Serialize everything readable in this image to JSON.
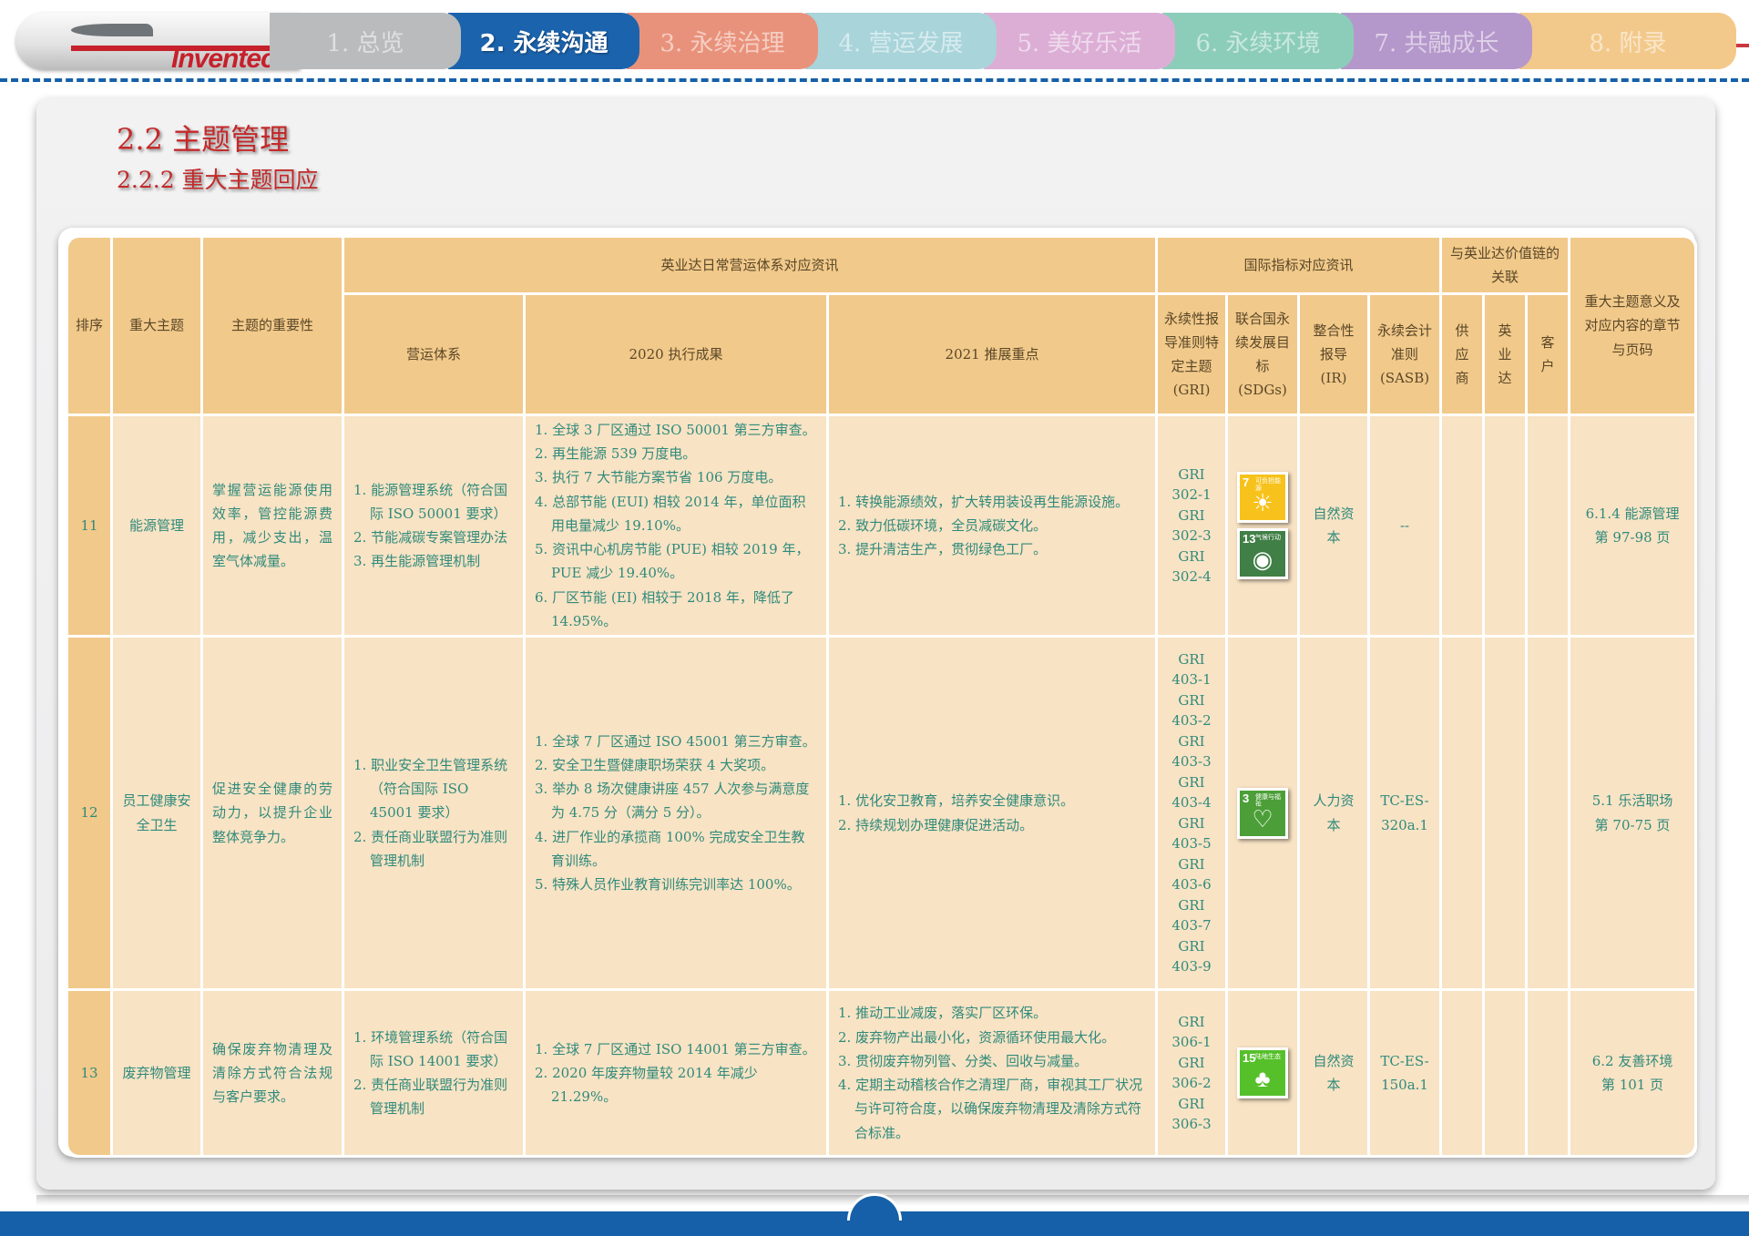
{
  "brand": {
    "logo_text": "Inventec"
  },
  "nav": {
    "tabs": [
      {
        "label": "1. 总览",
        "color": "#b9bbbd",
        "active": false
      },
      {
        "label": "2. 永续沟通",
        "color": "#1b63ad",
        "active": true
      },
      {
        "label": "3. 永续治理",
        "color": "#e9927b",
        "active": false
      },
      {
        "label": "4. 营运发展",
        "color": "#a8d4da",
        "active": false
      },
      {
        "label": "5. 美好乐活",
        "color": "#dcaed6",
        "active": false
      },
      {
        "label": "6. 永续环境",
        "color": "#8ccdb9",
        "active": false
      },
      {
        "label": "7. 共融成长",
        "color": "#b598cb",
        "active": false
      },
      {
        "label": "8. 附录",
        "color": "#f3c98b",
        "active": false
      }
    ]
  },
  "section": {
    "title": "2.2 主题管理",
    "subtitle": "2.2.2 重大主题回应"
  },
  "table": {
    "headers": {
      "rank": "排序",
      "topic": "重大主题",
      "importance": "主题的重要性",
      "ops_group": "英业达日常营运体系对应资讯",
      "ops_system": "营运体系",
      "results_2020": "2020 执行成果",
      "focus_2021": "2021 推展重点",
      "intl_group": "国际指标对应资讯",
      "gri": "永续性报导准则特定主题 (GRI)",
      "sdgs": "联合国永续发展目标 (SDGs)",
      "ir": "整合性报导 (IR)",
      "sasb": "永续会计准则 (SASB)",
      "value_chain_group": "与英业达价值链的关联",
      "supplier": "供应商",
      "inventec": "英业达",
      "customer": "客户",
      "meaning": "重大主题意义及对应内容的章节与页码"
    },
    "rows": [
      {
        "rank": "11",
        "topic": "能源管理",
        "importance": "掌握营运能源使用效率，管控能源费用，减少支出，温室气体减量。",
        "ops_system": [
          "1. 能源管理系统（符合国际 ISO 50001 要求）",
          "2. 节能减碳专案管理办法",
          "3. 再生能源管理机制"
        ],
        "results_2020": [
          "1. 全球 3 厂区通过 ISO 50001 第三方审查。",
          "2. 再生能源 539 万度电。",
          "3. 执行 7 大节能方案节省 106 万度电。",
          "4. 总部节能 (EUI) 相较 2014 年，单位面积用电量减少 19.10%。",
          "5. 资讯中心机房节能 (PUE) 相较 2019 年，PUE 减少 19.40%。",
          "6. 厂区节能 (EI) 相较于 2018 年，降低了 14.95%。"
        ],
        "focus_2021": [
          "1. 转换能源绩效，扩大转用装设再生能源设施。",
          "2. 致力低碳环境，全员减碳文化。",
          "3. 提升清洁生产，贯彻绿色工厂。"
        ],
        "gri": [
          "GRI",
          "302-1",
          "GRI",
          "302-3",
          "GRI",
          "302-4"
        ],
        "sdgs": [
          {
            "num": "7",
            "label": "可负担能源",
            "color": "#f7c21b",
            "icon": "sun-icon"
          },
          {
            "num": "13",
            "label": "气候行动",
            "color": "#407f46",
            "icon": "eye-globe-icon"
          }
        ],
        "ir": "自然资本",
        "sasb": "--",
        "supplier": "",
        "inventec": "",
        "customer": "",
        "meaning": [
          "6.1.4 能源管理",
          "第 97-98 页"
        ]
      },
      {
        "rank": "12",
        "topic": "员工健康安全卫生",
        "importance": "促进安全健康的劳动力，以提升企业整体竞争力。",
        "ops_system": [
          "1. 职业安全卫生管理系统（符合国际 ISO 45001 要求）",
          "2. 责任商业联盟行为准则管理机制"
        ],
        "results_2020": [
          "1. 全球 7 厂区通过 ISO 45001 第三方审查。",
          "2. 安全卫生暨健康职场荣获 4 大奖项。",
          "3. 举办 8 场次健康讲座 457 人次参与满意度为 4.75 分（满分 5 分）。",
          "4. 进厂作业的承揽商 100% 完成安全卫生教育训练。",
          "5. 特殊人员作业教育训练完训率达 100%。"
        ],
        "focus_2021": [
          "1. 优化安卫教育，培养安全健康意识。",
          "2. 持续规划办理健康促进活动。"
        ],
        "gri": [
          "GRI",
          "403-1",
          "GRI",
          "403-2",
          "GRI",
          "403-3",
          "GRI",
          "403-4",
          "GRI",
          "403-5",
          "GRI",
          "403-6",
          "GRI",
          "403-7",
          "GRI",
          "403-9"
        ],
        "sdgs": [
          {
            "num": "3",
            "label": "健康与福祉",
            "color": "#4c9f38",
            "icon": "heartbeat-icon"
          }
        ],
        "ir": "人力资本",
        "sasb": "TC-ES-320a.1",
        "supplier": "",
        "inventec": "",
        "customer": "",
        "meaning": [
          "5.1 乐活职场",
          "第 70-75 页"
        ]
      },
      {
        "rank": "13",
        "topic": "废弃物管理",
        "importance": "确保废弃物清理及清除方式符合法规与客户要求。",
        "ops_system": [
          "1. 环境管理系统（符合国际 ISO 14001 要求）",
          "2. 责任商业联盟行为准则管理机制"
        ],
        "results_2020": [
          "1. 全球 7 厂区通过 ISO 14001 第三方审查。",
          "2. 2020 年废弃物量较 2014 年减少 21.29%。"
        ],
        "focus_2021": [
          "1. 推动工业减废，落实厂区环保。",
          "2. 废弃物产出最小化，资源循环使用最大化。",
          "3. 贯彻废弃物列管、分类、回收与减量。",
          "4. 定期主动稽核合作之清理厂商，审视其工厂状况与许可符合度，以确保废弃物清理及清除方式符合标准。"
        ],
        "gri": [
          "GRI",
          "306-1",
          "GRI",
          "306-2",
          "GRI",
          "306-3"
        ],
        "sdgs": [
          {
            "num": "15",
            "label": "陆地生态",
            "color": "#56c02b",
            "icon": "tree-bird-icon"
          }
        ],
        "ir": "自然资本",
        "sasb": "TC-ES-150a.1",
        "supplier": "",
        "inventec": "",
        "customer": "",
        "meaning": [
          "6.2 友善环境",
          "第 101 页"
        ]
      }
    ]
  }
}
